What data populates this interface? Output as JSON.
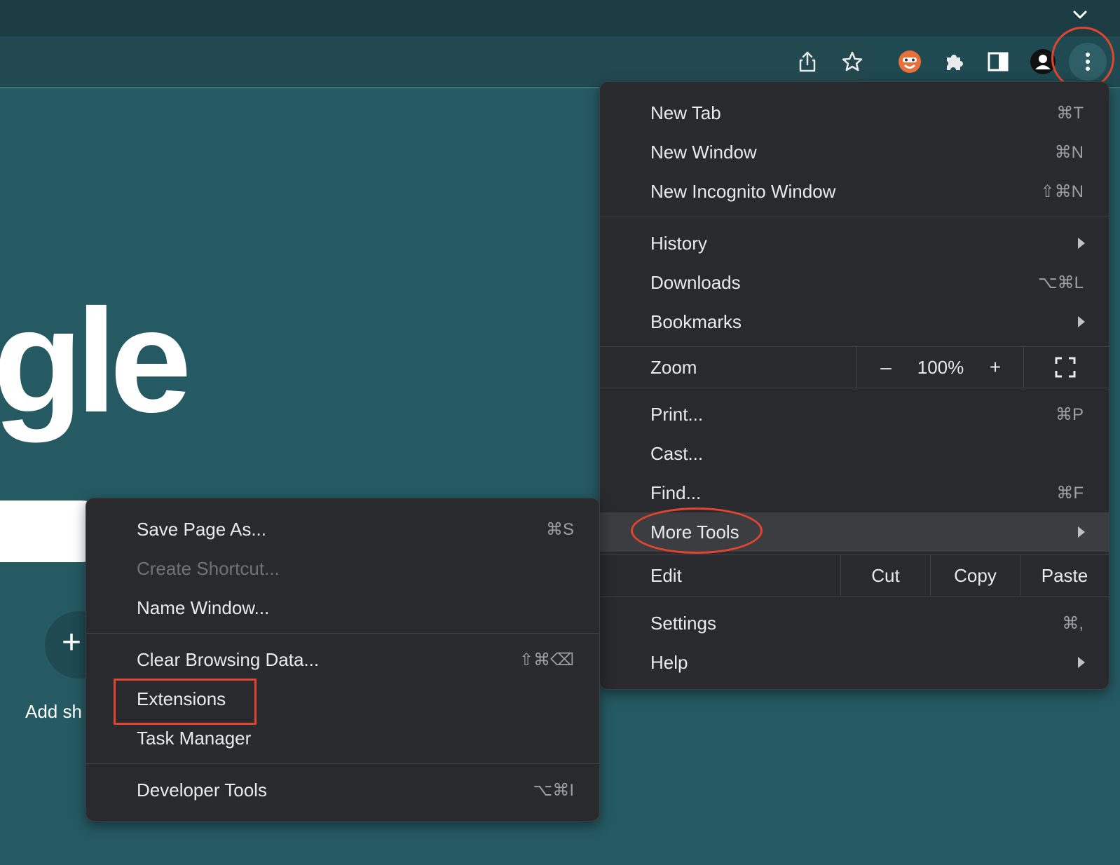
{
  "main_menu": {
    "items": [
      {
        "label": "New Tab",
        "shortcut": "⌘T"
      },
      {
        "label": "New Window",
        "shortcut": "⌘N"
      },
      {
        "label": "New Incognito Window",
        "shortcut": "⇧⌘N"
      },
      {
        "label": "History",
        "submenu": true
      },
      {
        "label": "Downloads",
        "shortcut": "⌥⌘L"
      },
      {
        "label": "Bookmarks",
        "submenu": true
      },
      {
        "label": "Print...",
        "shortcut": "⌘P"
      },
      {
        "label": "Cast...",
        "shortcut": ""
      },
      {
        "label": "Find...",
        "shortcut": "⌘F"
      },
      {
        "label": "More Tools",
        "submenu": true,
        "highlighted": true
      },
      {
        "label": "Settings",
        "shortcut": "⌘,"
      },
      {
        "label": "Help",
        "submenu": true
      }
    ],
    "zoom": {
      "label": "Zoom",
      "minus": "–",
      "value": "100%",
      "plus": "+"
    },
    "edit": {
      "label": "Edit",
      "cut": "Cut",
      "copy": "Copy",
      "paste": "Paste"
    }
  },
  "more_tools_menu": {
    "items": [
      {
        "label": "Save Page As...",
        "shortcut": "⌘S"
      },
      {
        "label": "Create Shortcut...",
        "disabled": true
      },
      {
        "label": "Name Window..."
      },
      {
        "label": "Clear Browsing Data...",
        "shortcut": "⇧⌘⌫"
      },
      {
        "label": "Extensions"
      },
      {
        "label": "Task Manager"
      },
      {
        "label": "Developer Tools",
        "shortcut": "⌥⌘I"
      }
    ]
  },
  "page": {
    "logo_fragment": "gle",
    "add_shortcut_plus": "+",
    "add_shortcut_label": "Add sh"
  },
  "icons": {
    "tab_chevron": "chevron-down-icon",
    "share": "share-icon",
    "bookmark": "star-icon",
    "extension_avatar": "extension-avatar-icon",
    "extensions": "puzzle-icon",
    "side_panel": "side-panel-icon",
    "profile": "profile-icon",
    "menu": "kebab-menu-icon"
  },
  "colors": {
    "annotation": "#e2452f",
    "menu_bg": "#292a2d",
    "page_bg": "#255a62"
  }
}
